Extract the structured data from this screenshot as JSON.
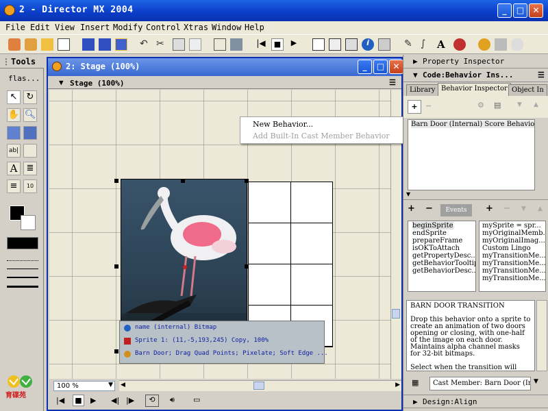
{
  "window": {
    "title": "2 - Director MX 2004"
  },
  "menu": [
    "File",
    "Edit",
    "View",
    "Insert",
    "Modify",
    "Control",
    "Xtras",
    "Window",
    "Help"
  ],
  "tools_palette": {
    "title": "Tools",
    "dropdown": "flas..."
  },
  "stage_window": {
    "title": "2: Stage (100%)",
    "subheader": "Stage (100%)",
    "zoom": "100 %",
    "sprite_info": {
      "line1": "name (internal) Bitmap",
      "line2": "Sprite 1: (11,-5,193,245) Copy, 100%",
      "line3": "Barn Door; Drag Quad Points; Pixelate; Soft Edge ..."
    }
  },
  "context_menu": {
    "new_behavior": "New Behavior...",
    "add_builtin": "Add Built-In Cast Member Behavior"
  },
  "right_panel": {
    "property_inspector": "Property Inspector",
    "code_panel": "Code:Behavior Ins...",
    "tabs": [
      "Library",
      "Behavior Inspector",
      "Object In"
    ],
    "behavior_list": [
      "Barn Door (Internal) Score Behavior"
    ],
    "events_label": "Events",
    "events": [
      "beginSprite",
      "endSprite",
      "prepareFrame",
      "isOKToAttach",
      "getPropertyDesc...",
      "getBehaviorTooltip",
      "getBehaviorDesc..."
    ],
    "actions": [
      "mySprite = spr...",
      "myOriginalMemb...",
      "myOriginalImag...",
      "Custom Lingo",
      "myTransitionMe...",
      "myTransitionMe...",
      "myTransitionMe...",
      "myTransitionMe..."
    ],
    "description_title": "BARN DOOR TRANSITION",
    "description": "Drop this behavior onto a sprite to create an animation of two doors opening or closing, with one-half of the image on each door. Maintains alpha channel masks for 32-bit bitmaps.",
    "description_more": "Select when the transition will take",
    "cast_member": "Cast Member:  Barn Door (In",
    "design_panel": "Design:Align"
  },
  "logo_text": "育碟苑",
  "icons": [
    "app-icon",
    "minimize-icon",
    "maximize-icon",
    "close-icon",
    "arrow-tool-icon",
    "rotate-tool-icon",
    "hand-tool-icon",
    "zoom-tool-icon",
    "play-icon",
    "stop-icon",
    "rewind-icon",
    "plus-icon",
    "minus-icon"
  ]
}
